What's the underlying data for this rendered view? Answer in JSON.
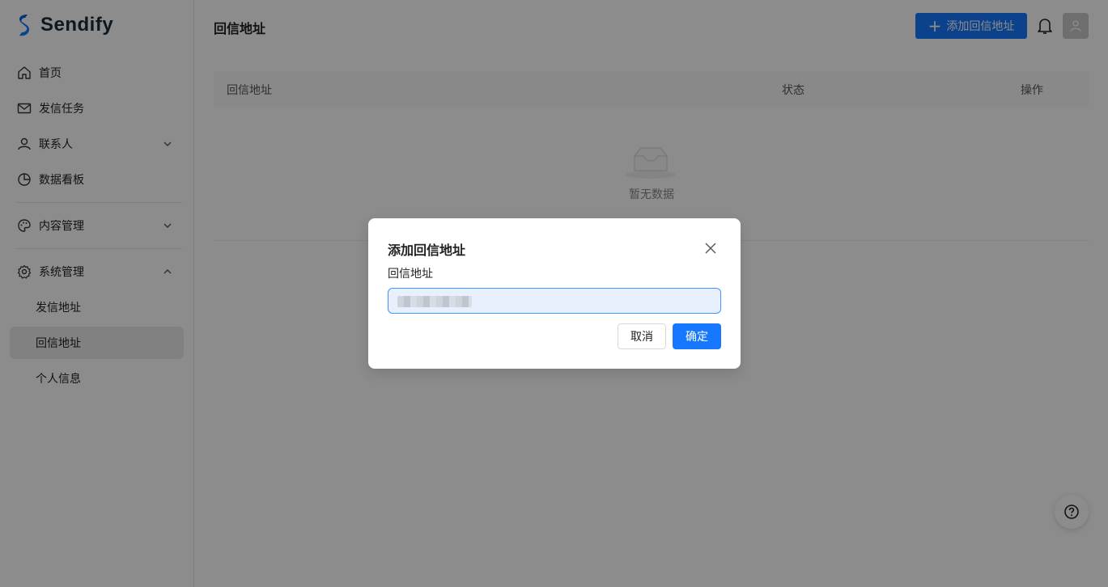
{
  "app": {
    "name": "Sendify"
  },
  "colors": {
    "primary": "#1677ff",
    "mask": "rgba(0,0,0,0.45)"
  },
  "sidebar": {
    "items": [
      {
        "label": "首页",
        "icon": "home-icon"
      },
      {
        "label": "发信任务",
        "icon": "mail-icon"
      },
      {
        "label": "联系人",
        "icon": "user-icon",
        "expandable": true
      },
      {
        "label": "数据看板",
        "icon": "pie-chart-icon"
      },
      {
        "label": "内容管理",
        "icon": "palette-icon",
        "expandable": true
      },
      {
        "label": "系统管理",
        "icon": "gear-icon",
        "expandable": true,
        "expanded": true
      },
      {
        "label": "发信地址"
      },
      {
        "label": "回信地址",
        "active": true
      },
      {
        "label": "个人信息"
      }
    ]
  },
  "header": {
    "title": "回信地址",
    "add_button_label": "添加回信地址"
  },
  "table": {
    "columns": [
      "回信地址",
      "状态",
      "操作"
    ],
    "empty_text": "暂无数据"
  },
  "modal": {
    "title": "添加回信地址",
    "field_label": "回信地址",
    "cancel_label": "取消",
    "ok_label": "确定"
  }
}
